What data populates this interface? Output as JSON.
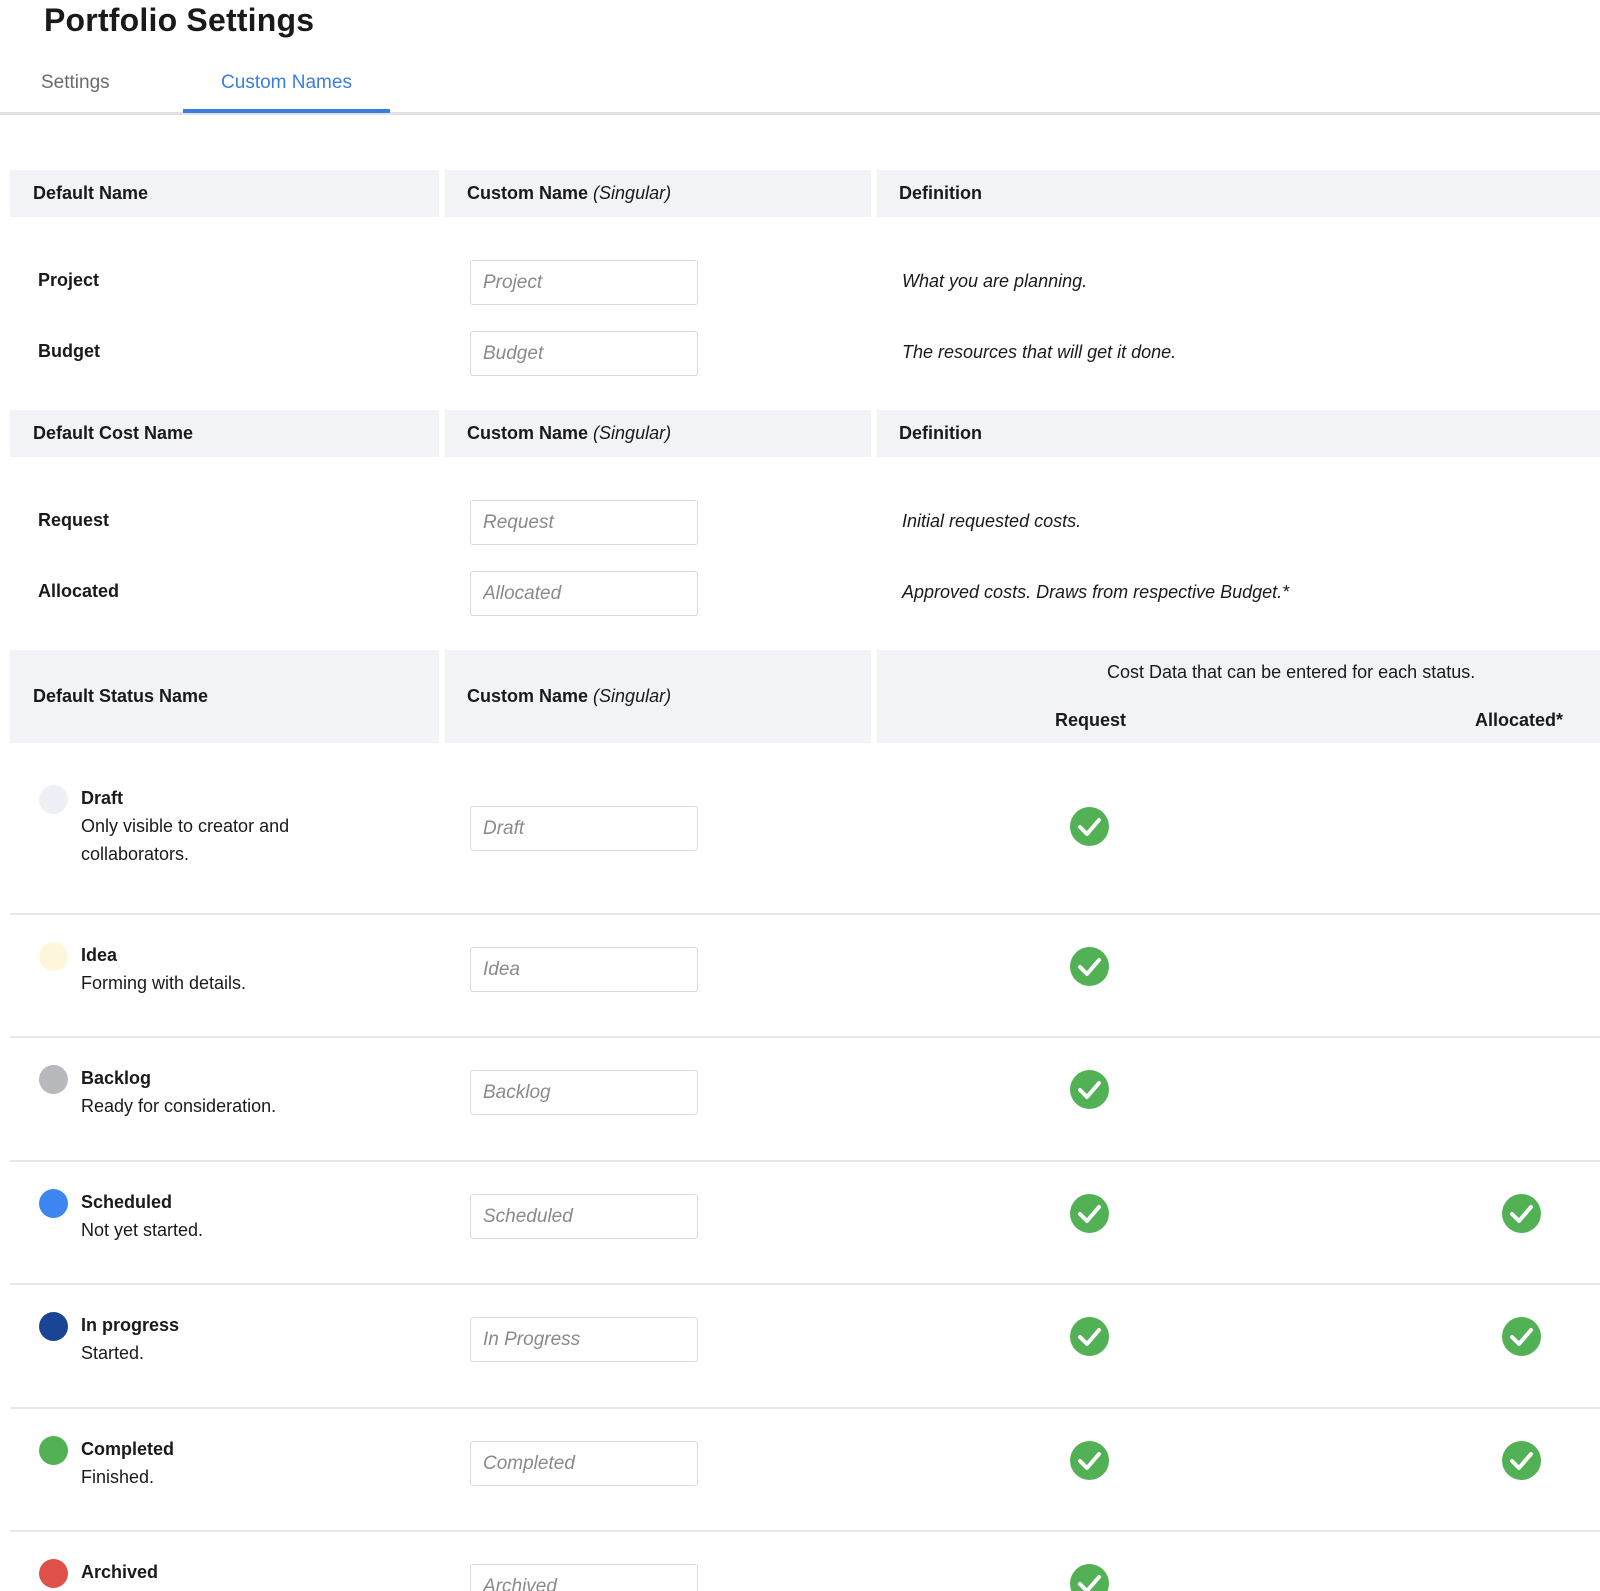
{
  "page": {
    "title": "Portfolio Settings"
  },
  "tabs": [
    {
      "label": "Settings",
      "active": false
    },
    {
      "label": "Custom Names",
      "active": true
    }
  ],
  "names_section": {
    "header": {
      "col1": "Default Name",
      "col2_main": "Custom Name",
      "col2_sub": "(Singular)",
      "col3": "Definition"
    },
    "rows": [
      {
        "default": "Project",
        "placeholder": "Project",
        "definition": "What you are planning."
      },
      {
        "default": "Budget",
        "placeholder": "Budget",
        "definition": "The resources that will get it done."
      }
    ]
  },
  "cost_section": {
    "header": {
      "col1": "Default Cost Name",
      "col2_main": "Custom Name",
      "col2_sub": "(Singular)",
      "col3": "Definition"
    },
    "rows": [
      {
        "default": "Request",
        "placeholder": "Request",
        "definition": "Initial requested costs."
      },
      {
        "default": "Allocated",
        "placeholder": "Allocated",
        "definition": "Approved costs. Draws from respective Budget.*"
      }
    ]
  },
  "status_section": {
    "header": {
      "col1": "Default Status Name",
      "col2_main": "Custom Name",
      "col2_sub": "(Singular)",
      "col3_caption": "Cost Data that can be entered for each status.",
      "col3_request": "Request",
      "col3_allocated": "Allocated*"
    },
    "rows": [
      {
        "name": "Draft",
        "desc_line1": "Only visible to creator and",
        "desc_line2": "collaborators.",
        "placeholder": "Draft",
        "color": "#eef0f6",
        "request": true,
        "allocated": false
      },
      {
        "name": "Idea",
        "desc_line1": "Forming with details.",
        "desc_line2": "",
        "placeholder": "Idea",
        "color": "#fdf6dc",
        "request": true,
        "allocated": false
      },
      {
        "name": "Backlog",
        "desc_line1": "Ready for consideration.",
        "desc_line2": "",
        "placeholder": "Backlog",
        "color": "#b8b9bd",
        "request": true,
        "allocated": false
      },
      {
        "name": "Scheduled",
        "desc_line1": "Not yet started.",
        "desc_line2": "",
        "placeholder": "Scheduled",
        "color": "#3d86f0",
        "request": true,
        "allocated": true
      },
      {
        "name": "In progress",
        "desc_line1": "Started.",
        "desc_line2": "",
        "placeholder": "In Progress",
        "color": "#1a4595",
        "request": true,
        "allocated": true
      },
      {
        "name": "Completed",
        "desc_line1": "Finished.",
        "desc_line2": "",
        "placeholder": "Completed",
        "color": "#52b154",
        "request": true,
        "allocated": true
      },
      {
        "name": "Archived",
        "desc_line1": "",
        "desc_line2": "",
        "placeholder": "Archived",
        "color": "#e0504b",
        "request": true,
        "allocated": false
      }
    ]
  },
  "colors": {
    "accent": "#3b7ee0",
    "check": "#52b154",
    "header_bg": "#f2f3f7"
  }
}
